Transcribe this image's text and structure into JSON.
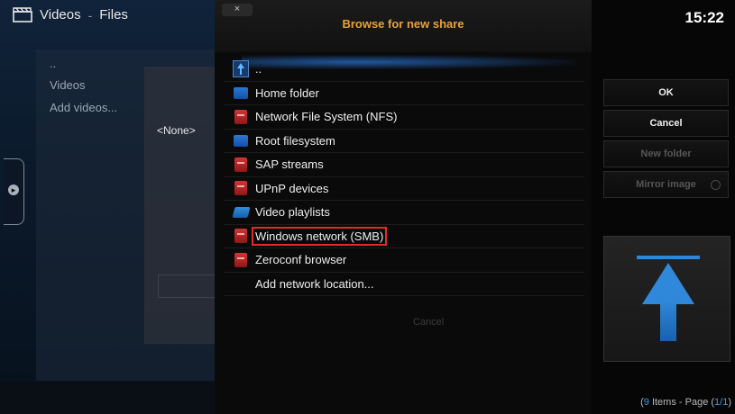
{
  "header": {
    "section": "Videos",
    "separator": "-",
    "subsection": "Files"
  },
  "left_list": {
    "items": [
      "..",
      "Videos",
      "Add videos..."
    ]
  },
  "left_dialog": {
    "selected_value": "<None>"
  },
  "dialog": {
    "close_label": "×",
    "title": "Browse for new share",
    "rows": [
      {
        "label": "..",
        "icon": "parent-folder-icon"
      },
      {
        "label": "Home folder",
        "icon": "folder-icon"
      },
      {
        "label": "Network File System (NFS)",
        "icon": "network-drive-icon"
      },
      {
        "label": "Root filesystem",
        "icon": "folder-icon"
      },
      {
        "label": "SAP streams",
        "icon": "network-drive-icon"
      },
      {
        "label": "UPnP devices",
        "icon": "network-drive-icon"
      },
      {
        "label": "Video playlists",
        "icon": "open-folder-icon"
      },
      {
        "label": "Windows network (SMB)",
        "icon": "network-drive-icon",
        "focused": true
      },
      {
        "label": "Zeroconf browser",
        "icon": "network-drive-icon"
      },
      {
        "label": "Add network location...",
        "icon": "none"
      }
    ],
    "background_cancel": "Cancel"
  },
  "right_panel": {
    "clock": "15:22",
    "ok": "OK",
    "cancel": "Cancel",
    "new_folder": "New folder",
    "mirror_image": "Mirror image",
    "preview_icon": "parent-folder-large-icon"
  },
  "page_info": {
    "count": "9",
    "items_text": " Items - Page (",
    "page": "1/1",
    "close": ")"
  },
  "colors": {
    "title": "#e8a23a",
    "focus_border": "#e12b2b",
    "accent_blue": "#3a9cf0"
  }
}
